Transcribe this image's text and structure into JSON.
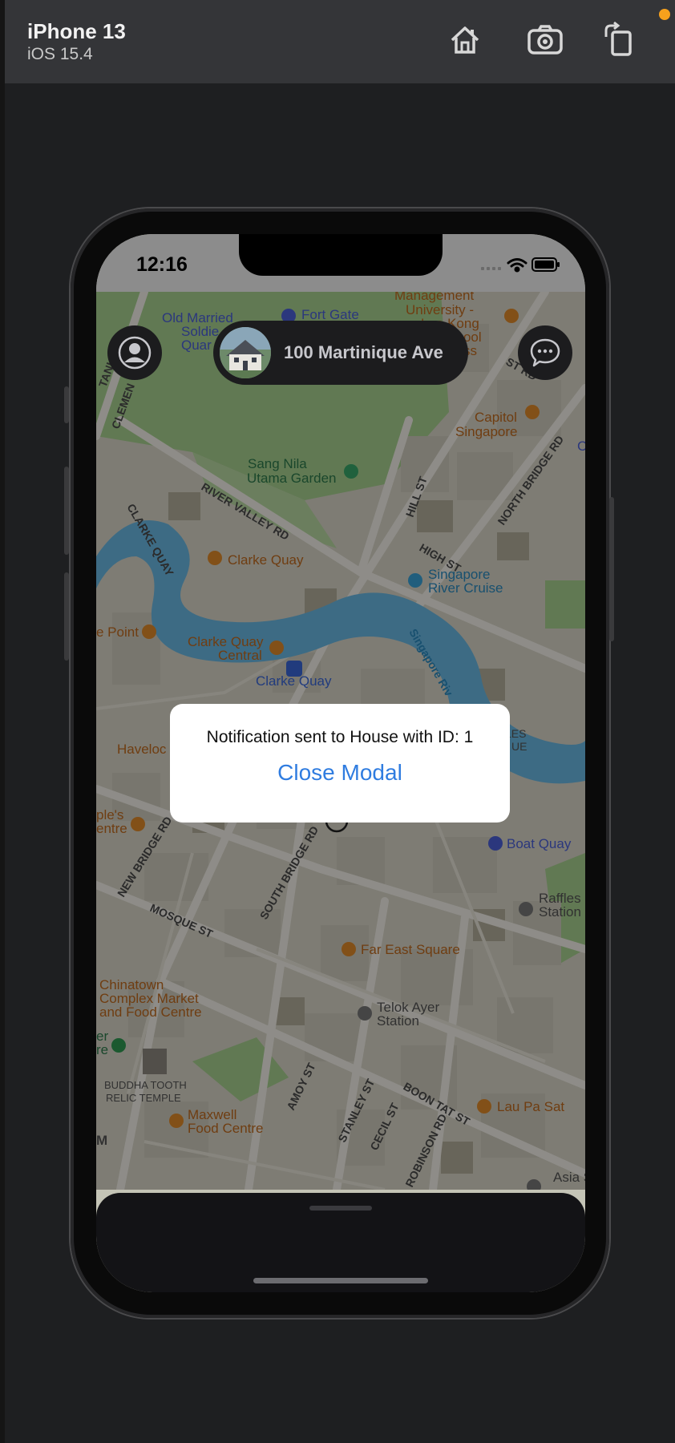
{
  "simulator": {
    "device_name": "iPhone 13",
    "os_version": "iOS 15.4",
    "toolbar_icons": [
      "home-icon",
      "screenshot-icon",
      "rotate-icon"
    ],
    "recording_dot_color": "#f7a11c"
  },
  "status_bar": {
    "time": "12:16",
    "icons": [
      "signal-icon",
      "wifi-icon",
      "battery-icon"
    ]
  },
  "map": {
    "labels": {
      "fort_gate": "Fort Gate",
      "old_married_1": "Old Married",
      "old_married_2": "Soldie",
      "old_married_3": "Quar",
      "management": "Management",
      "university": "University -",
      "lee_kong": "Lee Kong",
      "school": "chool",
      "ss": "ss",
      "capitol_1": "Capitol",
      "capitol_2": "Singapore",
      "north_bridge_rd": "NORTH BRIDGE RD",
      "hill_st": "HILL ST",
      "high_st": "HIGH ST",
      "sang_nila_1": "Sang Nila",
      "sang_nila_2": "Utama Garden",
      "river_valley_rd": "RIVER VALLEY RD",
      "clarke_quay_road": "CLARKE QUAY",
      "clemenceau": "CLEMEN",
      "tank_rd": "TANK RD",
      "st_rd": "ST RD",
      "clarke_quay": "Clarke Quay",
      "sg_river_cruise_1": "Singapore",
      "sg_river_cruise_2": "River Cruise",
      "singapore_river": "Singapore Riv",
      "point": "e Point",
      "cq_central_1": "Clarke Quay",
      "cq_central_2": "Central",
      "cq_station": "Clarke Quay",
      "havelock": "Haveloc",
      "les": "LES",
      "que": "UE",
      "temple_1": "ple's",
      "temple_2": "entre",
      "new_bridge_rd": "NEW BRIDGE RD",
      "south_bridge_rd": "SOUTH BRIDGE RD",
      "boat_quay": "Boat Quay",
      "raffles_1": "Raffles",
      "raffles_2": "Station",
      "mosque_st": "MOSQUE ST",
      "far_east_square": "Far East Square",
      "chinatown_1": "Chinatown",
      "chinatown_2": "Complex Market",
      "chinatown_3": "and Food Centre",
      "telok_ayer_1": "Telok Ayer",
      "telok_ayer_2": "Station",
      "er": "er",
      "re": "re",
      "buddha_1": "BUDDHA TOOTH",
      "buddha_2": "RELIC TEMPLE",
      "amoy_st": "AMOY ST",
      "boon_tat_st": "BOON TAT ST",
      "lau_pa_sat": "Lau Pa Sat",
      "maxwell_1": "Maxwell",
      "maxwell_2": "Food Centre",
      "m": "M",
      "stanley_st": "STANLEY ST",
      "cecil_st": "CECIL ST",
      "robinson_rd": "ROBINSON RD",
      "asia": "Asia S",
      "c": "C"
    }
  },
  "top_controls": {
    "profile_button_icon": "person-icon",
    "address": "100 Martinique Ave",
    "chat_button_icon": "chat-bubble-icon"
  },
  "modal": {
    "message": "Notification sent to House with ID: 1",
    "close_label": "Close Modal"
  }
}
